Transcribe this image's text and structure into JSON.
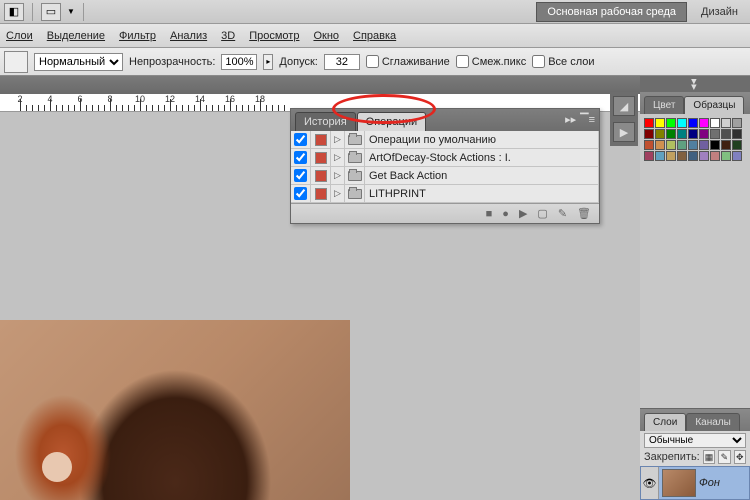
{
  "topbar": {
    "workspace_btn": "Основная рабочая среда",
    "design_label": "Дизайн"
  },
  "menu": {
    "layers": "Слои",
    "select": "Выделение",
    "filter": "Фильтр",
    "analysis": "Анализ",
    "threeD": "3D",
    "view": "Просмотр",
    "window": "Окно",
    "help": "Справка"
  },
  "optbar": {
    "mode_label": "Нормальный",
    "opacity_label": "Непрозрачность:",
    "opacity_value": "100%",
    "tolerance_label": "Допуск:",
    "tolerance_value": "32",
    "antialias": "Сглаживание",
    "contiguous": "Смеж.пикс",
    "all_layers": "Все слои"
  },
  "ruler": {
    "ticks": [
      2,
      4,
      6,
      8,
      10,
      12,
      14,
      16,
      18
    ]
  },
  "actions_panel": {
    "tab_history": "История",
    "tab_actions": "Операции",
    "rows": [
      {
        "name": "Операции по умолчанию"
      },
      {
        "name": "ArtOfDecay-Stock Actions : I."
      },
      {
        "name": "Get Back Action"
      },
      {
        "name": "LITHPRINT"
      }
    ]
  },
  "right": {
    "collapse_glyph": "▸▸",
    "color_tab": "Цвет",
    "swatches_tab": "Образцы",
    "layers_tab": "Слои",
    "channels_tab": "Каналы",
    "blend_mode": "Обычные",
    "lock_label": "Закрепить:",
    "bg_layer": "Фон"
  },
  "swatch_colors": [
    "#ff0000",
    "#ffff00",
    "#00ff00",
    "#00ffff",
    "#0000ff",
    "#ff00ff",
    "#ffffff",
    "#d0d0d0",
    "#a0a0a0",
    "#800000",
    "#808000",
    "#008000",
    "#008080",
    "#000080",
    "#800080",
    "#707070",
    "#505050",
    "#303030",
    "#c05030",
    "#d09050",
    "#b0c060",
    "#60a080",
    "#5080a0",
    "#7060a0",
    "#000000",
    "#402010",
    "#204020",
    "#a04060",
    "#60a0c0",
    "#c0a060",
    "#806040",
    "#406080",
    "#a080c0",
    "#c08080",
    "#80c080",
    "#8080c0"
  ]
}
